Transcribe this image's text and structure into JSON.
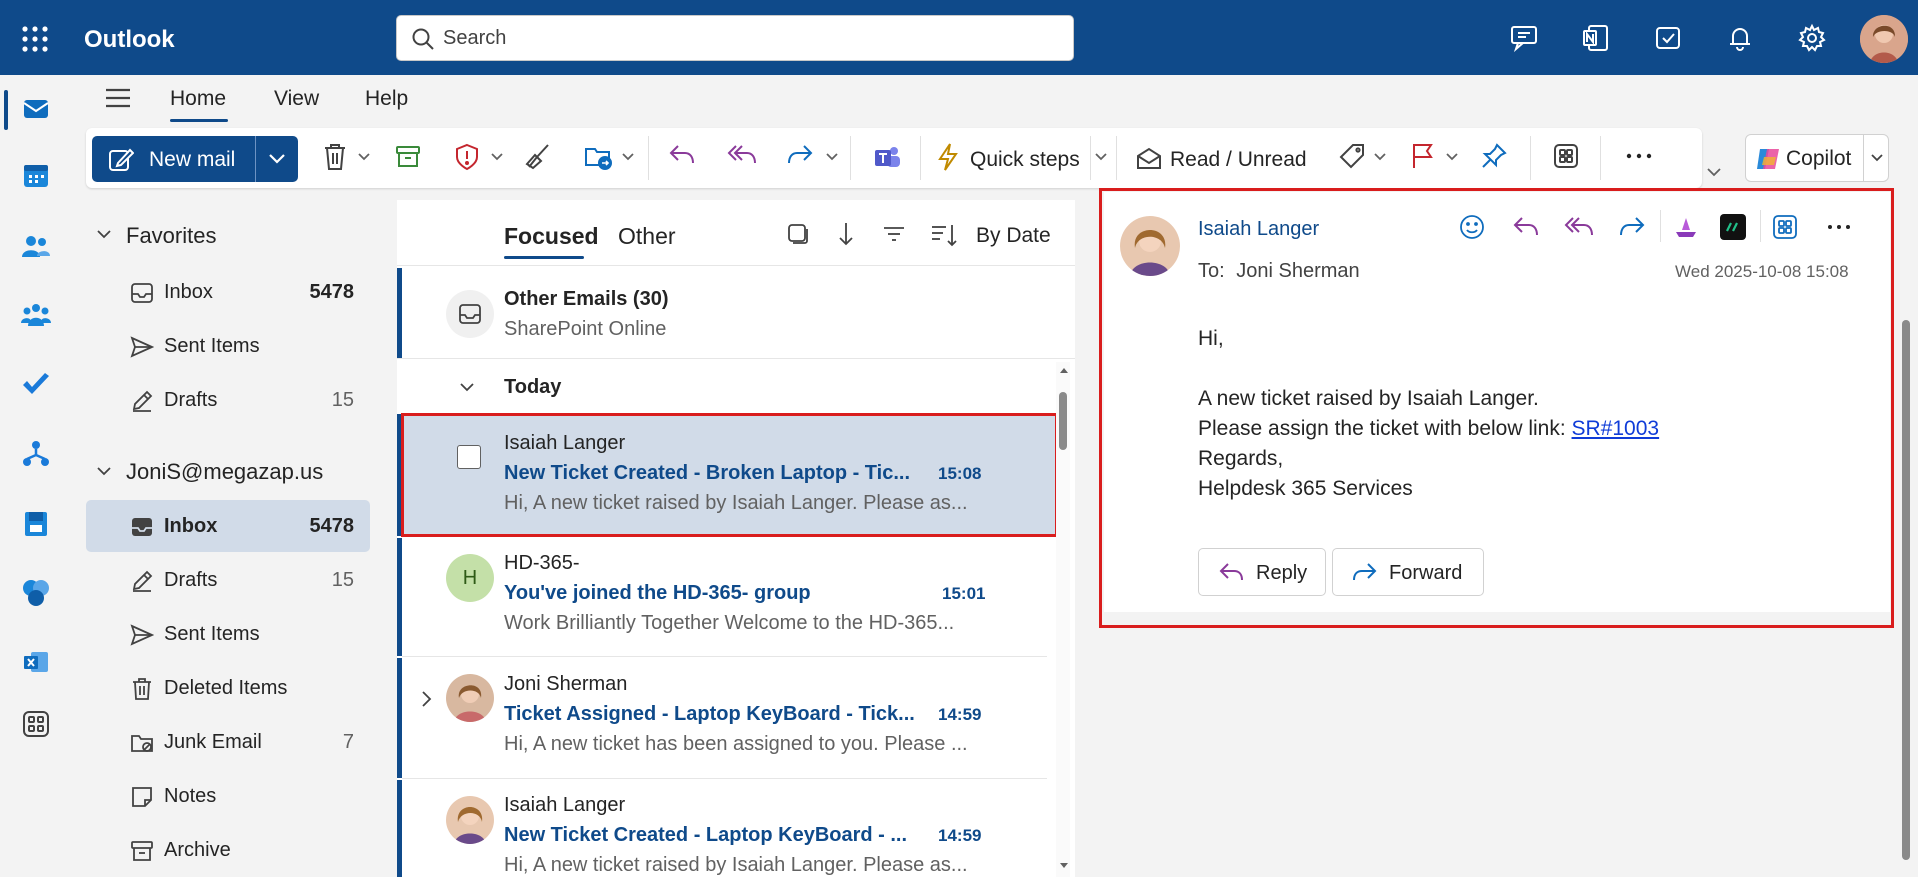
{
  "app": {
    "title": "Outlook"
  },
  "search": {
    "placeholder": "Search"
  },
  "tabs": {
    "home": "Home",
    "view": "View",
    "help": "Help"
  },
  "ribbon": {
    "new_mail": "New mail",
    "quick_steps": "Quick steps",
    "read_unread": "Read / Unread",
    "copilot": "Copilot"
  },
  "folders": {
    "favorites_title": "Favorites",
    "favorites": [
      {
        "label": "Inbox",
        "count": "5478"
      },
      {
        "label": "Sent Items",
        "count": ""
      },
      {
        "label": "Drafts",
        "count": "15"
      }
    ],
    "account_title": "JoniS@megazap.us",
    "account": [
      {
        "label": "Inbox",
        "count": "5478"
      },
      {
        "label": "Drafts",
        "count": "15"
      },
      {
        "label": "Sent Items",
        "count": ""
      },
      {
        "label": "Deleted Items",
        "count": ""
      },
      {
        "label": "Junk Email",
        "count": "7"
      },
      {
        "label": "Notes",
        "count": ""
      },
      {
        "label": "Archive",
        "count": ""
      }
    ]
  },
  "list": {
    "tab_focused": "Focused",
    "tab_other": "Other",
    "sort_label": "By Date",
    "other_emails": {
      "title": "Other Emails (30)",
      "source": "SharePoint Online"
    },
    "group_today": "Today",
    "messages": [
      {
        "sender": "Isaiah Langer",
        "subject": "New Ticket Created - Broken Laptop - Tic...",
        "time": "15:08",
        "preview": "Hi, A new ticket raised by Isaiah Langer. Please as..."
      },
      {
        "sender": "HD-365-",
        "subject": "You've joined the HD-365- group",
        "time": "15:01",
        "preview": "Work Brilliantly Together Welcome to the HD-365...",
        "avatar_letter": "H"
      },
      {
        "sender": "Joni Sherman",
        "subject": "Ticket Assigned - Laptop KeyBoard - Tick...",
        "time": "14:59",
        "preview": "Hi, A new ticket has been assigned to you. Please ..."
      },
      {
        "sender": "Isaiah Langer",
        "subject": "New Ticket Created - Laptop KeyBoard - ...",
        "time": "14:59",
        "preview": "Hi, A new ticket raised by Isaiah Langer. Please as..."
      }
    ]
  },
  "reading": {
    "sender": "Isaiah Langer",
    "to_label": "To:",
    "to": "Joni Sherman",
    "date": "Wed 2025-10-08 15:08",
    "greeting": "Hi,",
    "line1": "A new ticket raised by Isaiah Langer.",
    "line2_prefix": "Please assign the ticket with below link: ",
    "link_text": "SR#1003",
    "line3": "Regards,",
    "line4": "Helpdesk 365 Services",
    "reply": "Reply",
    "forward": "Forward"
  },
  "colors": {
    "brand": "#0f4a8a",
    "highlight": "#d91d1d",
    "selected_row": "#d1dbe8"
  }
}
